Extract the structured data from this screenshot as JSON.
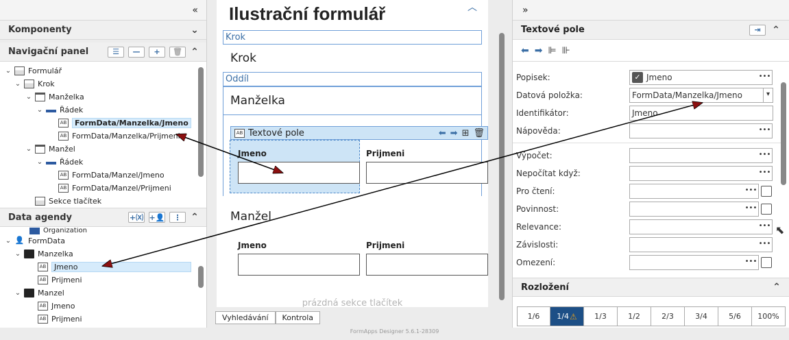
{
  "left": {
    "collapse_icon": "double-chevron-left-icon",
    "components": {
      "title": "Komponenty"
    },
    "nav": {
      "title": "Navigační panel",
      "tree": [
        {
          "label": "Formulář",
          "icon": "form-icon"
        },
        {
          "label": "Krok",
          "icon": "step-icon"
        },
        {
          "label": "Manželka",
          "icon": "section-icon"
        },
        {
          "label": "Řádek",
          "icon": "row-icon"
        },
        {
          "label": "FormData/Manzelka/Jmeno",
          "icon": "textfield-icon"
        },
        {
          "label": "FormData/Manzelka/Prijmeni",
          "icon": "textfield-icon"
        },
        {
          "label": "Manžel",
          "icon": "section-icon"
        },
        {
          "label": "Řádek",
          "icon": "row-icon"
        },
        {
          "label": "FormData/Manzel/Jmeno",
          "icon": "textfield-icon"
        },
        {
          "label": "FormData/Manzel/Prijmeni",
          "icon": "textfield-icon"
        },
        {
          "label": "Sekce tlačítek",
          "icon": "buttons-icon"
        }
      ]
    },
    "agenda": {
      "title": "Data agendy",
      "tree": [
        {
          "label": "Organization"
        },
        {
          "label": "FormData"
        },
        {
          "label": "Manzelka"
        },
        {
          "label": "Jmeno"
        },
        {
          "label": "Prijmeni"
        },
        {
          "label": "Manzel"
        },
        {
          "label": "Jmeno"
        },
        {
          "label": "Prijmeni"
        }
      ]
    }
  },
  "center": {
    "title": "Ilustrační formulář",
    "step_box": "Krok",
    "step_heading": "Krok",
    "section_box": "Oddíl",
    "section1_heading": "Manželka",
    "selected_field": "Textové pole",
    "col1_label": "Jmeno",
    "col2_label": "Prijmeni",
    "section2_heading": "Manžel",
    "col3_label": "Jmeno",
    "col4_label": "Prijmeni",
    "empty_buttons": "prázdná sekce tlačítek",
    "tabs": [
      "Vyhledávání",
      "Kontrola"
    ]
  },
  "right": {
    "title": "Textové pole",
    "props": {
      "popisek_label": "Popisek:",
      "popisek_value": "Jmeno",
      "datova_label": "Datová položka:",
      "datova_value": "FormData/Manzelka/Jmeno",
      "ident_label": "Identifikátor:",
      "ident_value": "Jmeno",
      "napoveda_label": "Nápověda:",
      "vypocet_label": "Výpočet:",
      "nepocitat_label": "Nepočítat když:",
      "procteni_label": "Pro čtení:",
      "povinnost_label": "Povinnost:",
      "relevance_label": "Relevance:",
      "zavislosti_label": "Závislosti:",
      "omezeni_label": "Omezení:"
    },
    "layout": {
      "title": "Rozložení",
      "options": [
        "1/6",
        "1/4",
        "1/3",
        "1/2",
        "2/3",
        "3/4",
        "5/6",
        "100%"
      ],
      "active": "1/4"
    }
  },
  "footer": {
    "version": "FormApps Designer 5.6.1-28309"
  }
}
